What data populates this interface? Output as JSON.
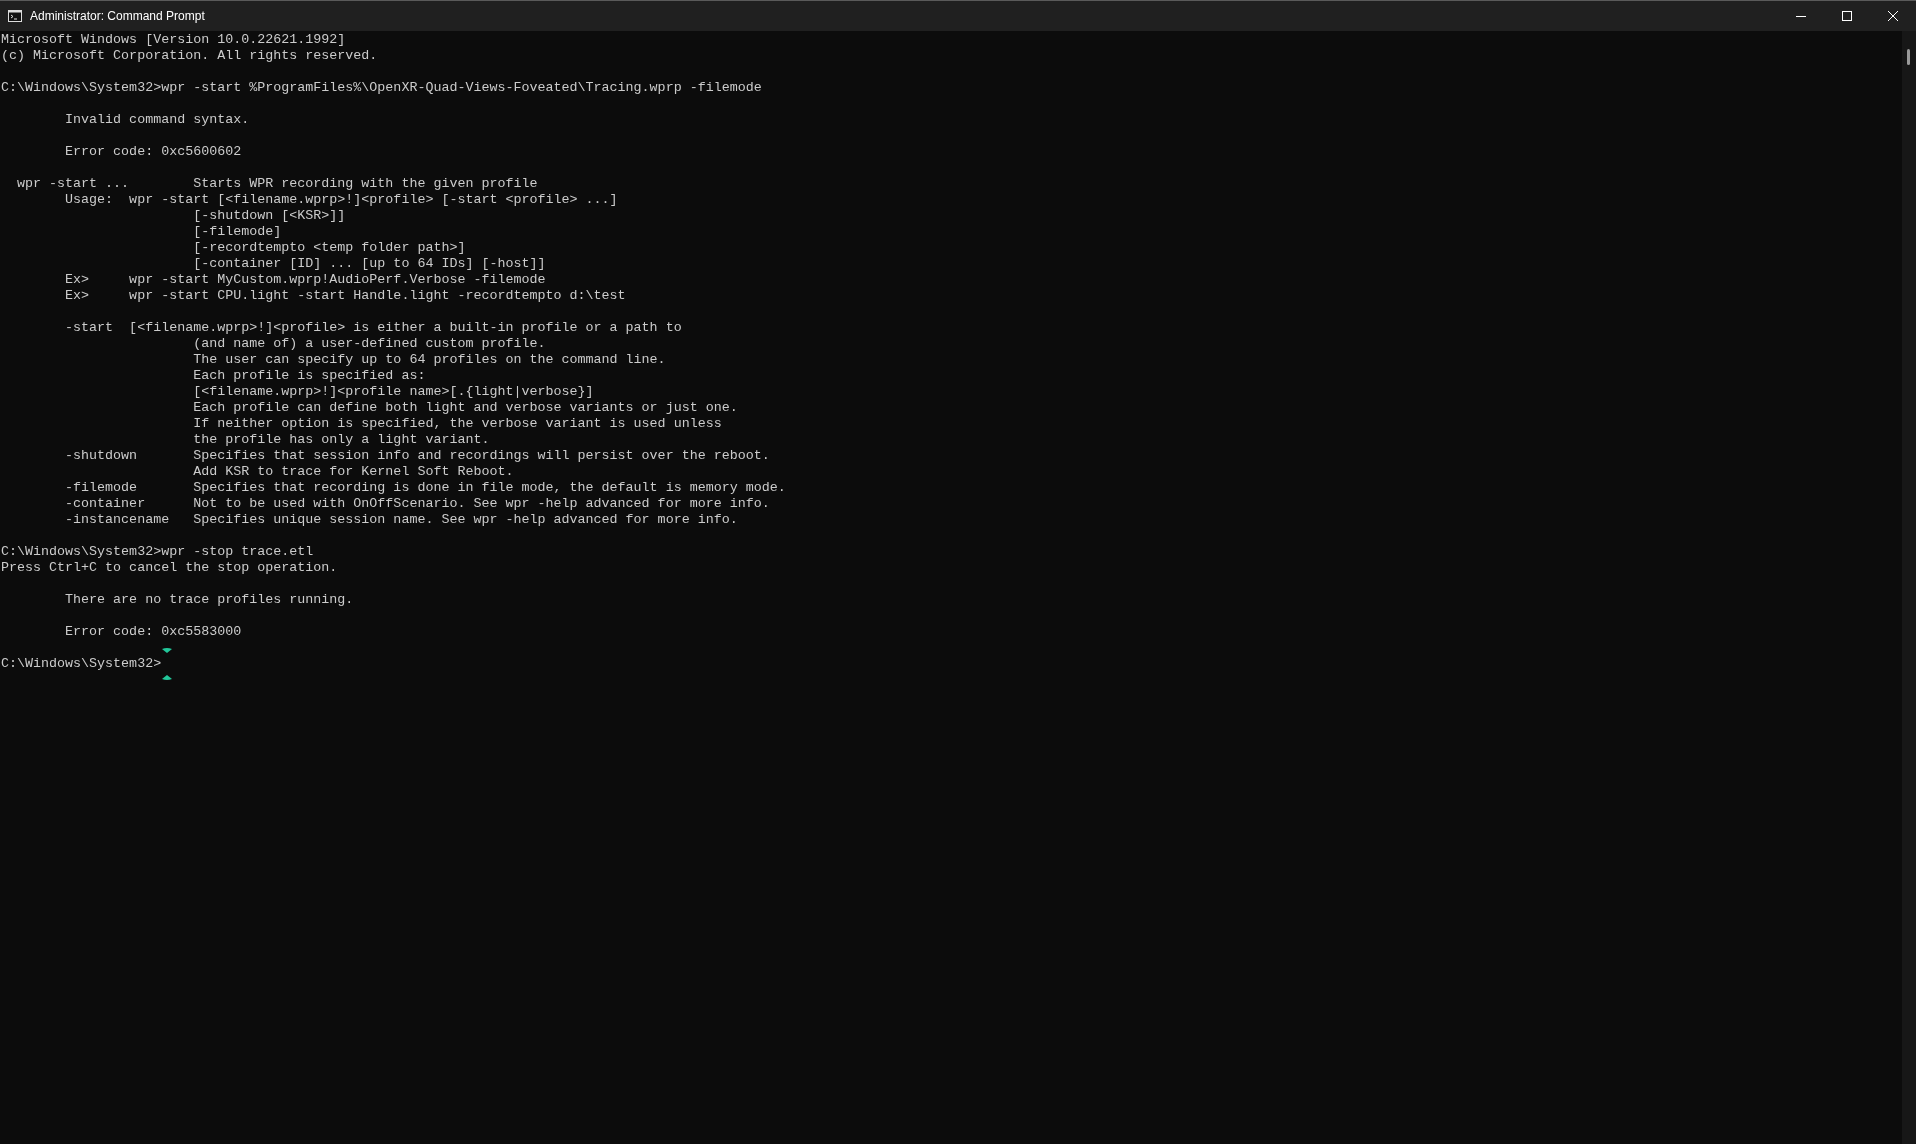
{
  "window": {
    "title": "Administrator: Command Prompt"
  },
  "console": {
    "blocks": [
      {
        "lines": [
          "Microsoft Windows [Version 10.0.22621.1992]",
          "(c) Microsoft Corporation. All rights reserved."
        ]
      },
      {
        "lines": [
          "C:\\Windows\\System32>wpr -start %ProgramFiles%\\OpenXR-Quad-Views-Foveated\\Tracing.wprp -filemode"
        ]
      },
      {
        "lines": [
          "        Invalid command syntax."
        ]
      },
      {
        "lines": [
          "        Error code: 0xc5600602"
        ]
      },
      {
        "lines": [
          "  wpr -start ...        Starts WPR recording with the given profile",
          "        Usage:  wpr -start [<filename.wprp>!]<profile> [-start <profile> ...]",
          "                        [-shutdown [<KSR>]]",
          "                        [-filemode]",
          "                        [-recordtempto <temp folder path>]",
          "                        [-container [ID] ... [up to 64 IDs] [-host]]",
          "        Ex>     wpr -start MyCustom.wprp!AudioPerf.Verbose -filemode",
          "        Ex>     wpr -start CPU.light -start Handle.light -recordtempto d:\\test"
        ]
      },
      {
        "lines": [
          "        -start  [<filename.wprp>!]<profile> is either a built-in profile or a path to",
          "                        (and name of) a user-defined custom profile.",
          "                        The user can specify up to 64 profiles on the command line.",
          "                        Each profile is specified as:",
          "                        [<filename.wprp>!]<profile name>[.{light|verbose}]",
          "                        Each profile can define both light and verbose variants or just one.",
          "                        If neither option is specified, the verbose variant is used unless",
          "                        the profile has only a light variant.",
          "        -shutdown       Specifies that session info and recordings will persist over the reboot.",
          "                        Add KSR to trace for Kernel Soft Reboot.",
          "        -filemode       Specifies that recording is done in file mode, the default is memory mode.",
          "        -container      Not to be used with OnOffScenario. See wpr -help advanced for more info.",
          "        -instancename   Specifies unique session name. See wpr -help advanced for more info."
        ]
      },
      {
        "lines": [
          "C:\\Windows\\System32>wpr -stop trace.etl",
          "Press Ctrl+C to cancel the stop operation."
        ]
      },
      {
        "lines": [
          "        There are no trace profiles running."
        ]
      },
      {
        "lines": [
          "        Error code: 0xc5583000"
        ]
      }
    ],
    "prompt": "C:\\Windows\\System32>"
  }
}
